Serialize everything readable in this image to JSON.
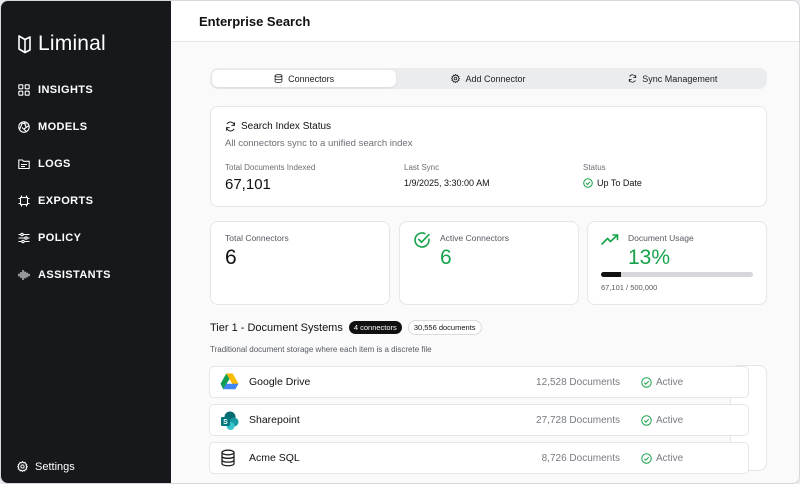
{
  "sidebar": {
    "logo_text": "Liminal",
    "items": [
      {
        "label": "INSIGHTS",
        "icon": "grid-icon"
      },
      {
        "label": "MODELS",
        "icon": "aperture-icon"
      },
      {
        "label": "LOGS",
        "icon": "folder-icon"
      },
      {
        "label": "EXPORTS",
        "icon": "frame-icon"
      },
      {
        "label": "POLICY",
        "icon": "sliders-icon"
      },
      {
        "label": "ASSISTANTS",
        "icon": "waveform-icon"
      }
    ],
    "settings_label": "Settings"
  },
  "header": {
    "title": "Enterprise Search"
  },
  "tabs": [
    {
      "label": "Connectors",
      "icon": "database-icon",
      "active": true
    },
    {
      "label": "Add Connector",
      "icon": "gear-icon",
      "active": false
    },
    {
      "label": "Sync Management",
      "icon": "refresh-icon",
      "active": false
    }
  ],
  "index_status": {
    "title": "Search Index Status",
    "subtitle": "All connectors sync to a unified search index",
    "total_docs_label": "Total Documents Indexed",
    "total_docs_value": "67,101",
    "last_sync_label": "Last Sync",
    "last_sync_value": "1/9/2025, 3:30:00 AM",
    "status_label": "Status",
    "status_value": "Up To Date"
  },
  "stats": {
    "total_connectors": {
      "label": "Total Connectors",
      "value": "6"
    },
    "active_connectors": {
      "label": "Active Connectors",
      "value": "6"
    },
    "document_usage": {
      "label": "Document Usage",
      "value": "13%",
      "detail": "67,101 / 500,000",
      "fraction": 0.134
    }
  },
  "tier1": {
    "title": "Tier 1 - Document Systems",
    "badge_connectors": "4 connectors",
    "badge_documents": "30,556 documents",
    "description": "Traditional document storage where each item is a discrete file",
    "rows": [
      {
        "name": "Google Drive",
        "docs": "12,528 Documents",
        "status": "Active",
        "icon": "google-drive-icon"
      },
      {
        "name": "Sharepoint",
        "docs": "27,728 Documents",
        "status": "Active",
        "icon": "sharepoint-icon"
      },
      {
        "name": "Acme SQL",
        "docs": "8,726 Documents",
        "status": "Active",
        "icon": "database-icon"
      }
    ]
  },
  "colors": {
    "accent_green": "#16a34a",
    "sidebar_bg": "#16181b"
  }
}
